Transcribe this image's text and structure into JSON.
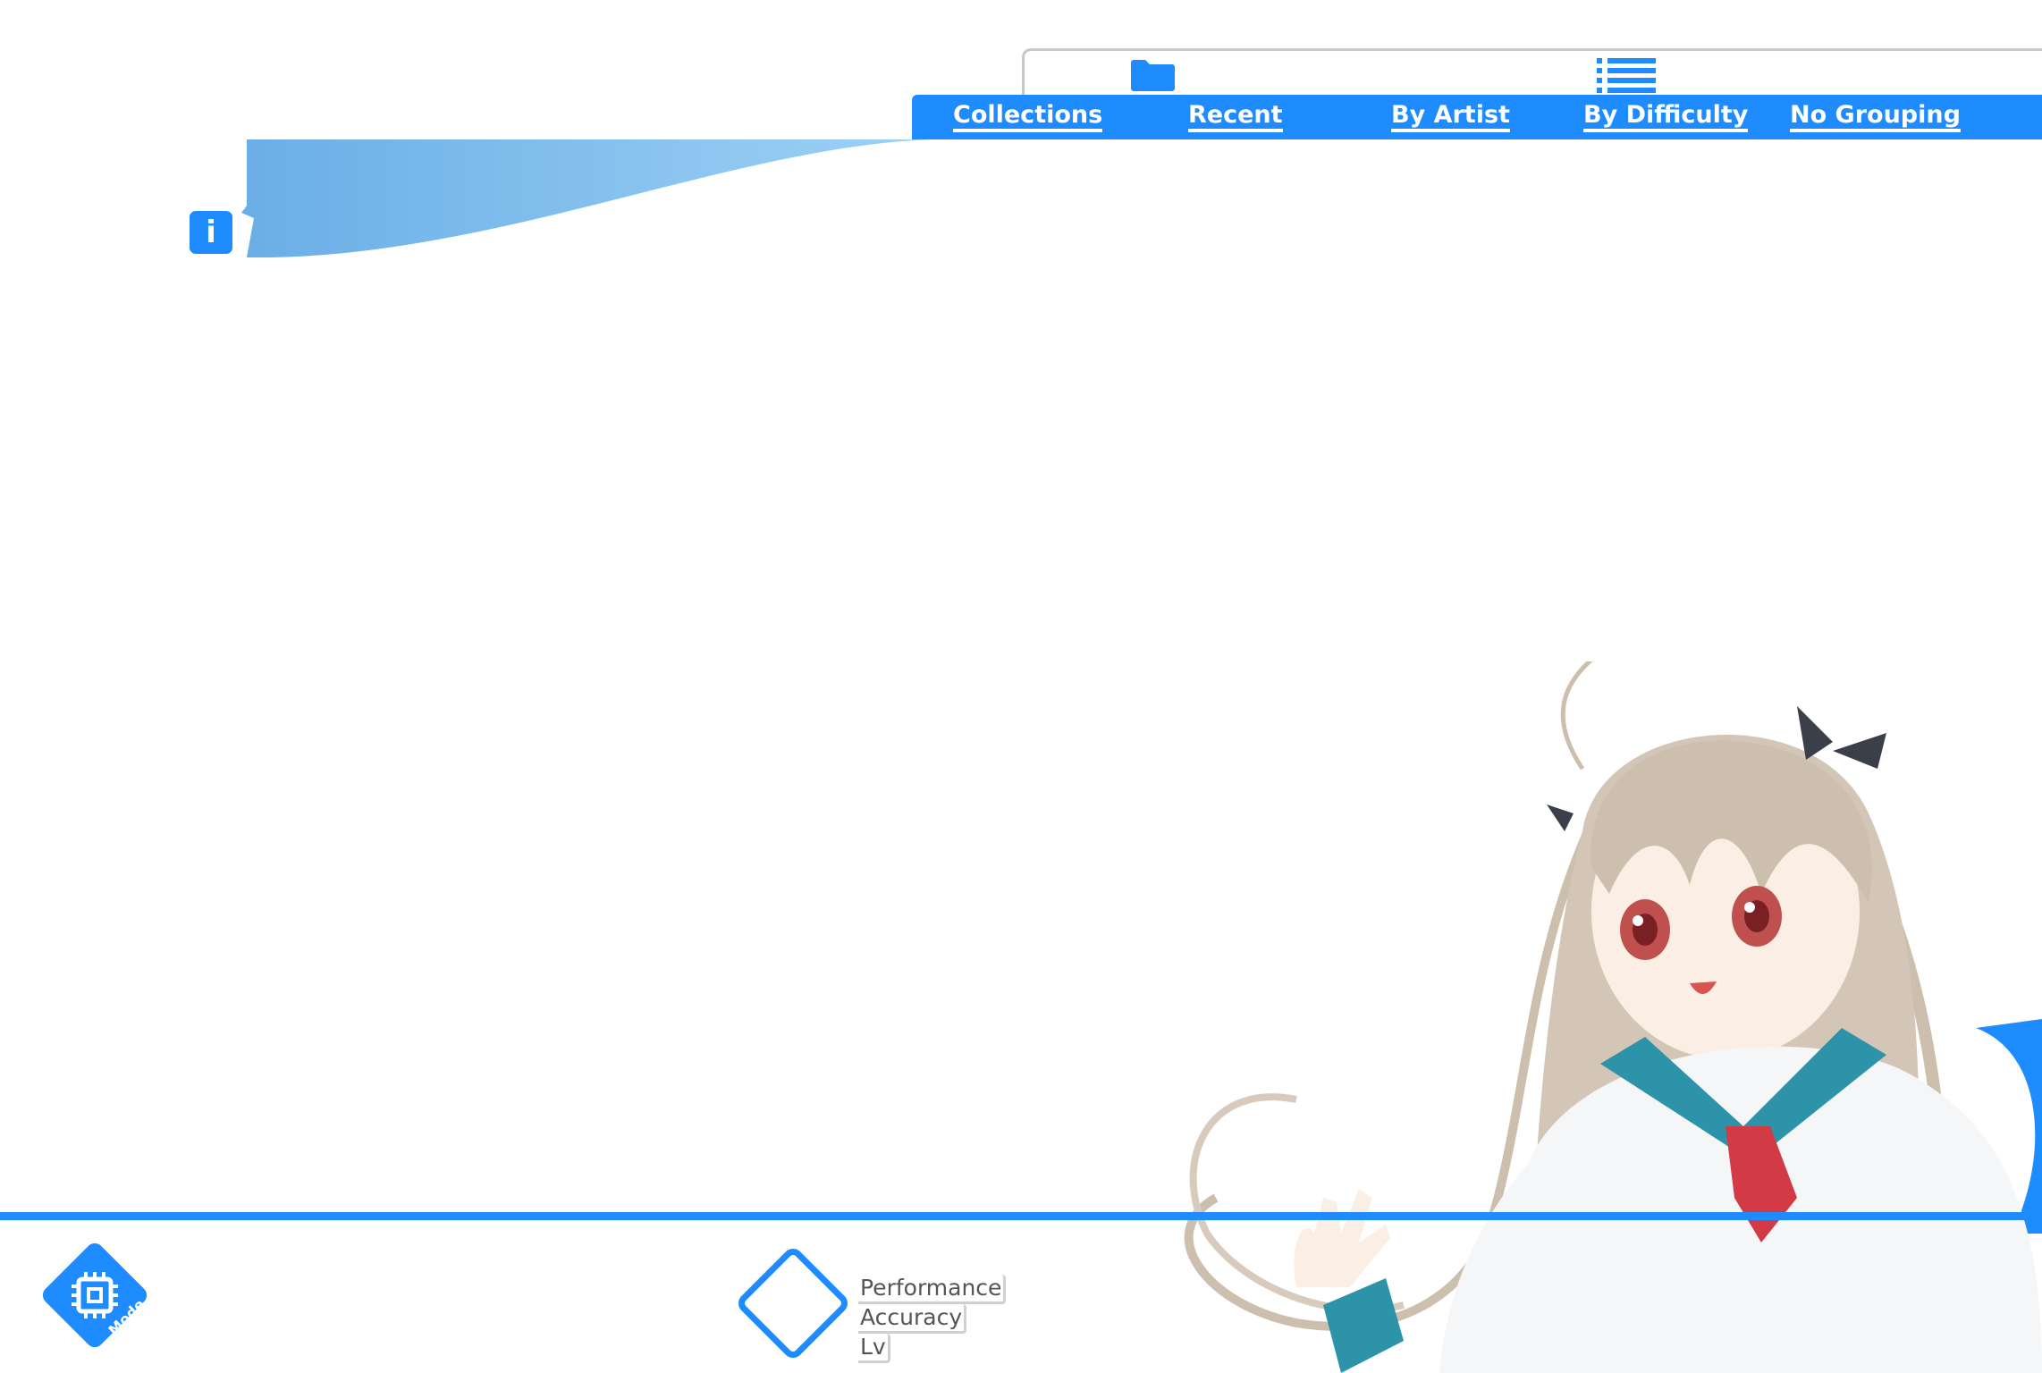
{
  "tabs": [
    {
      "label": "Collections"
    },
    {
      "label": "Recent"
    },
    {
      "label": "By Artist"
    },
    {
      "label": "By Difficulty"
    },
    {
      "label": "No Grouping"
    }
  ],
  "info_badge": "i",
  "mode_button": {
    "label": "Mode",
    "icon": "chip-icon"
  },
  "stats_labels": {
    "performance": "Performance",
    "accuracy": "Accuracy",
    "level": "Lv"
  },
  "colors": {
    "accent": "#1e8cff",
    "ribbon_light": "#8ec7f2",
    "ribbon_dark": "#6aaee6"
  }
}
